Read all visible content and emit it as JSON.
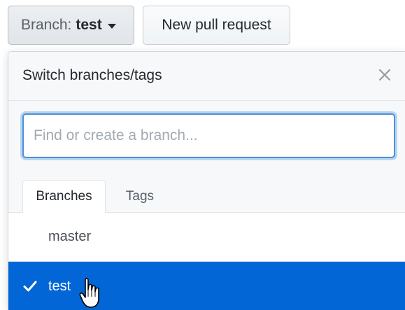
{
  "toolbar": {
    "branch_prefix": "Branch:",
    "branch_name": "test",
    "new_pr_label": "New pull request"
  },
  "dropdown": {
    "title": "Switch branches/tags",
    "close_icon": "close-icon",
    "filter_placeholder": "Find or create a branch...",
    "tabs": [
      {
        "label": "Branches",
        "active": true
      },
      {
        "label": "Tags",
        "active": false
      }
    ],
    "branches": [
      {
        "name": "master",
        "selected": false
      },
      {
        "name": "test",
        "selected": true
      }
    ],
    "selected_icon": "check-icon"
  },
  "colors": {
    "selected_bg": "#0366d6",
    "focus_border": "#4a90d9"
  }
}
